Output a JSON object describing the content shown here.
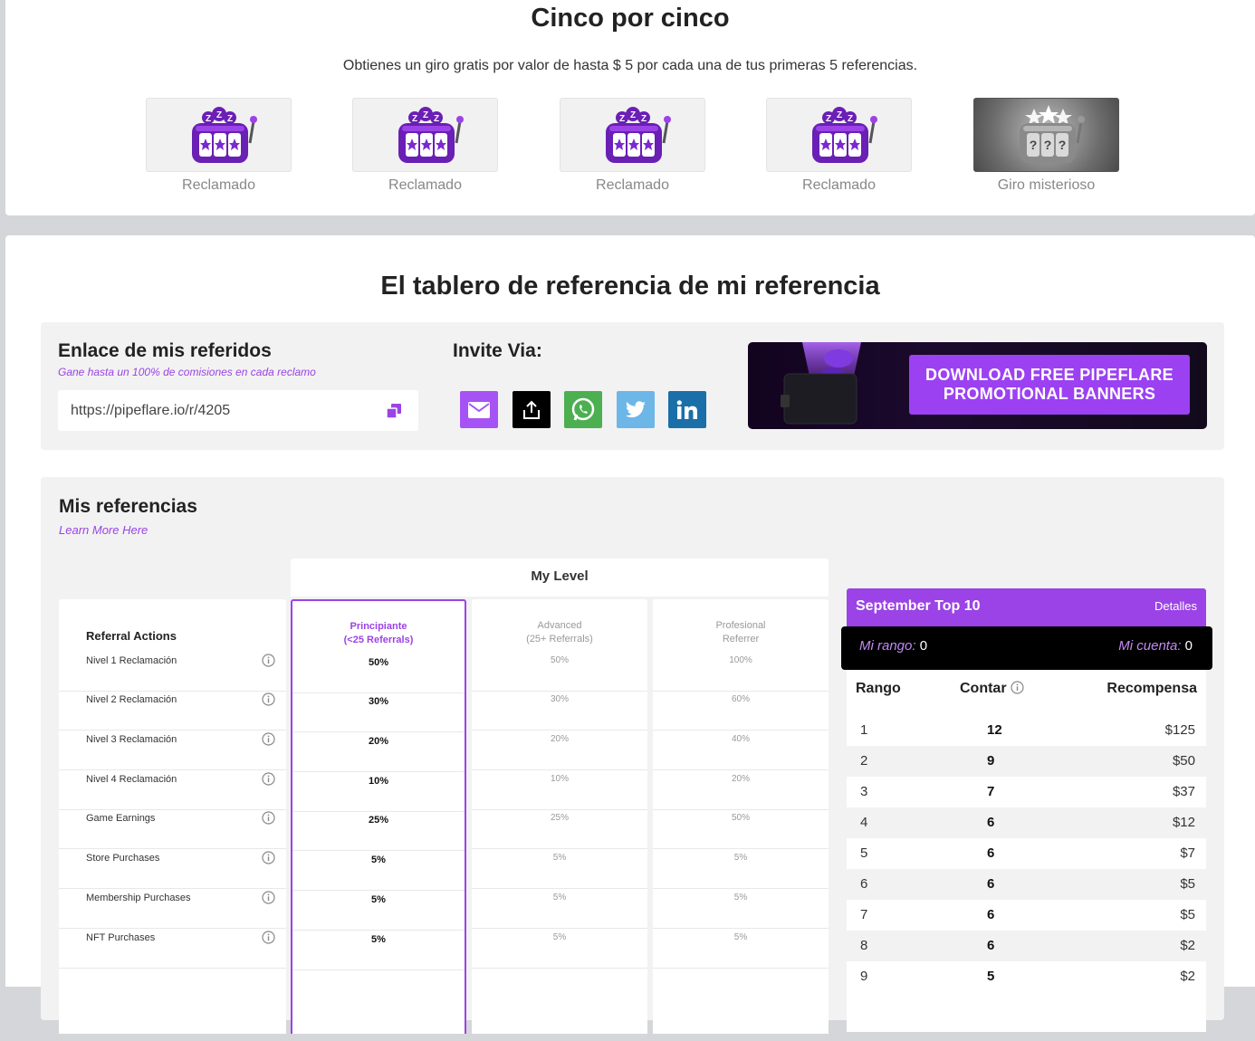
{
  "five_by_five": {
    "title": "Cinco por cinco",
    "subtitle": "Obtienes un giro gratis por valor de hasta $ 5 por cada una de tus primeras 5 referencias.",
    "slots": [
      {
        "label": "Reclamado",
        "state": "claimed"
      },
      {
        "label": "Reclamado",
        "state": "claimed"
      },
      {
        "label": "Reclamado",
        "state": "claimed"
      },
      {
        "label": "Reclamado",
        "state": "claimed"
      },
      {
        "label": "Giro misterioso",
        "state": "mystery"
      }
    ]
  },
  "dashboard": {
    "title": "El tablero de referencia de mi referencia",
    "link": {
      "heading": "Enlace de mis referidos",
      "subheading": "Gane hasta un 100% de comisiones en cada reclamo",
      "url": "https://pipeflare.io/r/4205",
      "copy_icon": "copy-icon"
    },
    "invite": {
      "heading": "Invite Via:",
      "buttons": [
        {
          "icon": "email-icon",
          "color": "#a653f5"
        },
        {
          "icon": "share-icon",
          "color": "#000000"
        },
        {
          "icon": "whatsapp-icon",
          "color": "#4caf50"
        },
        {
          "icon": "twitter-icon",
          "color": "#6cb6e8"
        },
        {
          "icon": "linkedin-icon",
          "color": "#1a6fa8"
        }
      ]
    },
    "banner": {
      "line1": "DOWNLOAD FREE PIPEFLARE",
      "line2": "PROMOTIONAL BANNERS"
    }
  },
  "referrals": {
    "heading": "Mis referencias",
    "learn_more": "Learn More Here",
    "my_level": "My Level",
    "actions_header": "Referral Actions",
    "levels": [
      {
        "name": "Principiante",
        "note": "(<25 Referrals)"
      },
      {
        "name": "Advanced",
        "note": "(25+ Referrals)"
      },
      {
        "name": "Profesional",
        "note": "Referrer"
      }
    ],
    "rows": [
      {
        "label": "Nivel 1 Reclamación",
        "values": [
          "50%",
          "50%",
          "100%"
        ]
      },
      {
        "label": "Nivel 2 Reclamación",
        "values": [
          "30%",
          "30%",
          "60%"
        ]
      },
      {
        "label": "Nivel 3 Reclamación",
        "values": [
          "20%",
          "20%",
          "40%"
        ]
      },
      {
        "label": "Nivel 4 Reclamación",
        "values": [
          "10%",
          "10%",
          "20%"
        ]
      },
      {
        "label": "Game Earnings",
        "values": [
          "25%",
          "25%",
          "50%"
        ]
      },
      {
        "label": "Store Purchases",
        "values": [
          "5%",
          "5%",
          "5%"
        ]
      },
      {
        "label": "Membership Purchases",
        "values": [
          "5%",
          "5%",
          "5%"
        ]
      },
      {
        "label": "NFT Purchases",
        "values": [
          "5%",
          "5%",
          "5%"
        ]
      }
    ]
  },
  "top10": {
    "title": "September Top 10",
    "details": "Detalles",
    "my_rank_label": "Mi rango:",
    "my_rank": "0",
    "my_count_label": "Mi cuenta:",
    "my_count": "0",
    "headers": {
      "rank": "Rango",
      "count": "Contar",
      "reward": "Recompensa"
    },
    "rows": [
      {
        "rank": "1",
        "count": "12",
        "reward": "$125"
      },
      {
        "rank": "2",
        "count": "9",
        "reward": "$50"
      },
      {
        "rank": "3",
        "count": "7",
        "reward": "$37"
      },
      {
        "rank": "4",
        "count": "6",
        "reward": "$12"
      },
      {
        "rank": "5",
        "count": "6",
        "reward": "$7"
      },
      {
        "rank": "6",
        "count": "6",
        "reward": "$5"
      },
      {
        "rank": "7",
        "count": "6",
        "reward": "$5"
      },
      {
        "rank": "8",
        "count": "6",
        "reward": "$2"
      },
      {
        "rank": "9",
        "count": "5",
        "reward": "$2"
      }
    ]
  }
}
